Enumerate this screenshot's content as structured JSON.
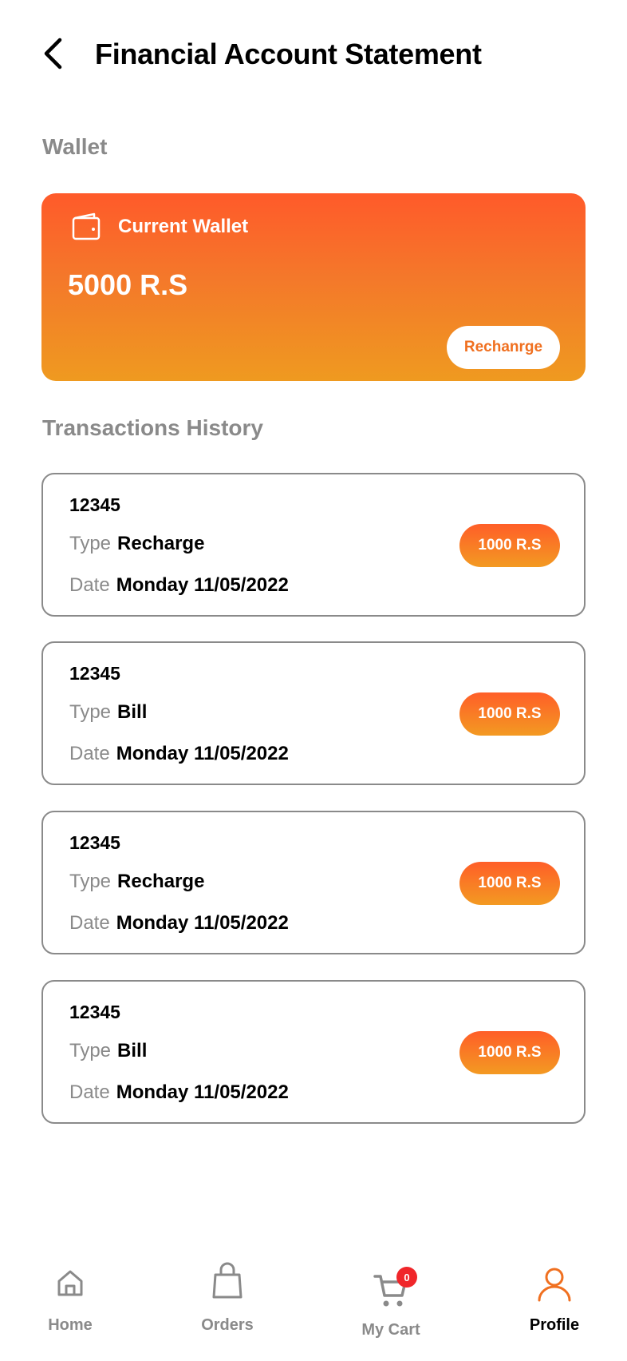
{
  "header": {
    "title": "Financial Account Statement"
  },
  "wallet": {
    "section_title": "Wallet",
    "card_label": "Current Wallet",
    "balance": "5000 R.S",
    "recharge_label": "Rechanrge"
  },
  "history": {
    "section_title": "Transactions History",
    "transactions": [
      {
        "id": "12345",
        "type_key": "Type",
        "type": "Recharge",
        "date_key": "Date",
        "date": "Monday 11/05/2022",
        "amount": "1000 R.S"
      },
      {
        "id": "12345",
        "type_key": "Type",
        "type": "Bill",
        "date_key": "Date",
        "date": "Monday 11/05/2022",
        "amount": "1000 R.S"
      },
      {
        "id": "12345",
        "type_key": "Type",
        "type": "Recharge",
        "date_key": "Date",
        "date": "Monday 11/05/2022",
        "amount": "1000 R.S"
      },
      {
        "id": "12345",
        "type_key": "Type",
        "type": "Bill",
        "date_key": "Date",
        "date": "Monday 11/05/2022",
        "amount": "1000 R.S"
      }
    ]
  },
  "bottom_nav": {
    "items": [
      {
        "label": "Home",
        "icon": "home-icon"
      },
      {
        "label": "Orders",
        "icon": "bag-icon"
      },
      {
        "label": "My Cart",
        "icon": "cart-icon",
        "badge": "0"
      },
      {
        "label": "Profile",
        "icon": "user-icon",
        "active": true
      }
    ]
  },
  "colors": {
    "accent": "#f07020",
    "gradient_top": "#ff5a2a",
    "gradient_bottom": "#ef9a20",
    "muted_text": "#8a8a8a",
    "badge": "#f0262a"
  }
}
